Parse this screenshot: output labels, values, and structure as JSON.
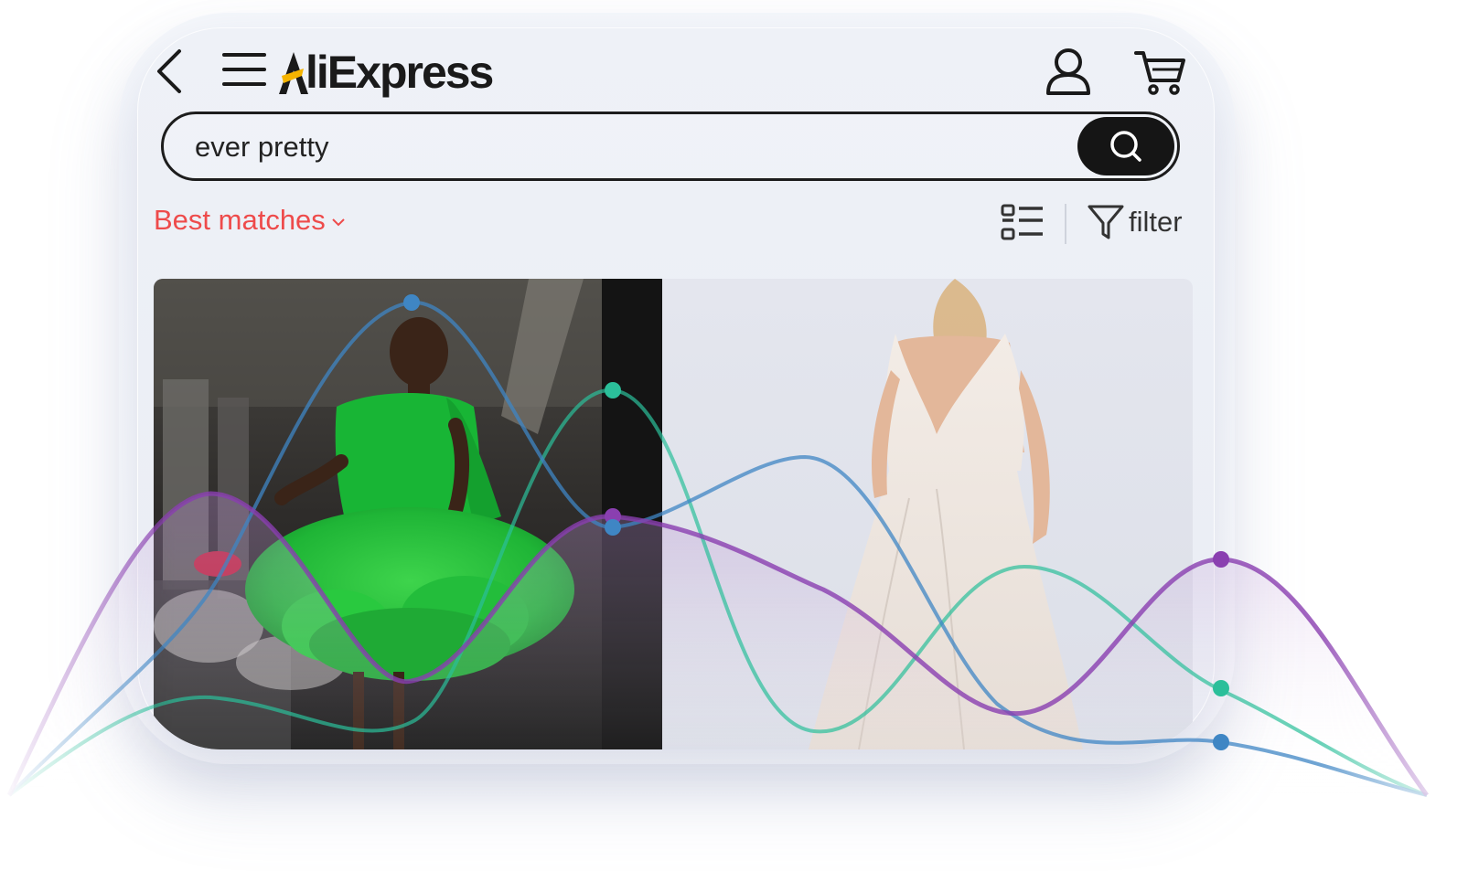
{
  "app": {
    "logo_text": "liExpress",
    "logo_letter": "A"
  },
  "search": {
    "value": "ever pretty"
  },
  "toolbar": {
    "sort_label": "Best matches",
    "filter_label": "filter"
  },
  "products": [
    {
      "image": "product-photo-green-ruffle-dress"
    },
    {
      "image": "product-photo-white-slip-dress"
    }
  ],
  "icons": {
    "back": "chevron-left-icon",
    "menu": "hamburger-icon",
    "account": "user-icon",
    "cart": "cart-icon",
    "search": "search-icon",
    "view": "list-view-icon",
    "filter": "funnel-icon"
  },
  "colors": {
    "sort_accent": "#ee4b4b",
    "logo_accent": "#f5b400",
    "series_blue": "#3f86c4",
    "series_teal": "#2bbf9a",
    "series_purple": "#8a3fb0"
  }
}
